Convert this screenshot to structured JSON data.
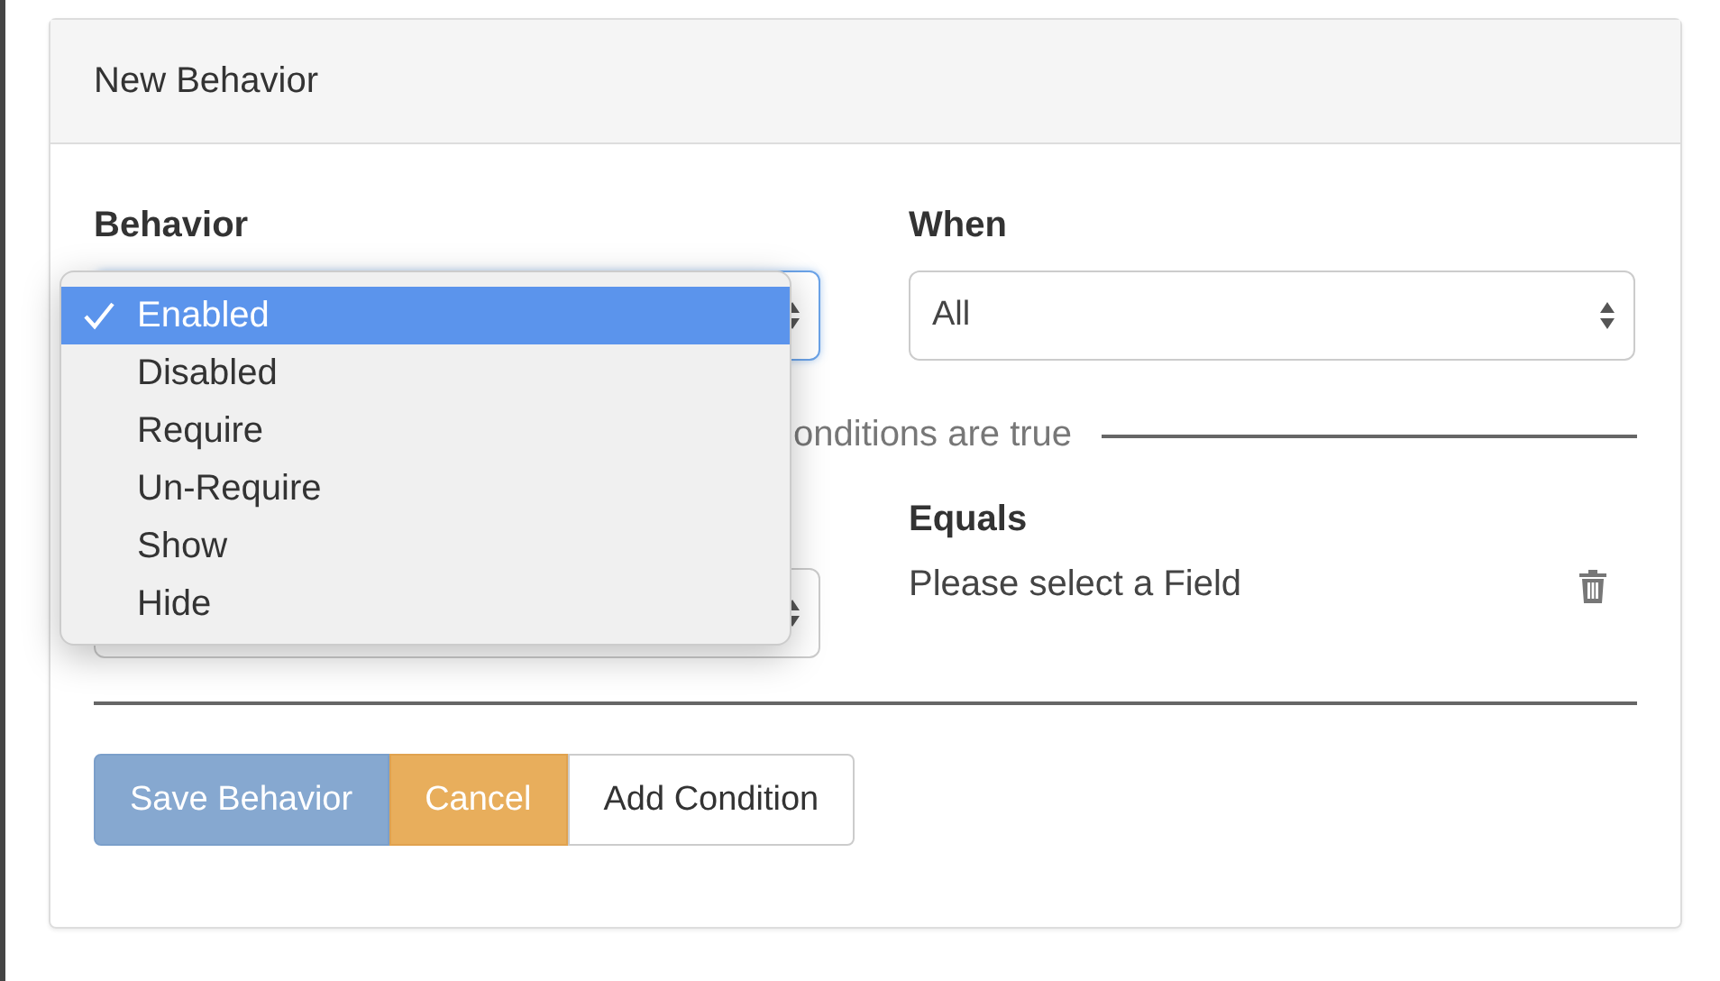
{
  "panel": {
    "title": "New Behavior"
  },
  "behavior": {
    "label": "Behavior",
    "focused": true,
    "menu": [
      {
        "label": "Enabled",
        "selected": true
      },
      {
        "label": "Disabled",
        "selected": false
      },
      {
        "label": "Require",
        "selected": false
      },
      {
        "label": "Un-Require",
        "selected": false
      },
      {
        "label": "Show",
        "selected": false
      },
      {
        "label": "Hide",
        "selected": false
      }
    ]
  },
  "when": {
    "label": "When",
    "value": "All"
  },
  "conditions_divider": {
    "text": "onditions are true"
  },
  "condition": {
    "equals_label": "Equals",
    "equals_value": "Please select a Field"
  },
  "buttons": [
    {
      "label": "Save Behavior",
      "kind": "primary"
    },
    {
      "label": "Cancel",
      "kind": "warning"
    },
    {
      "label": "Add Condition",
      "kind": "default"
    }
  ]
}
